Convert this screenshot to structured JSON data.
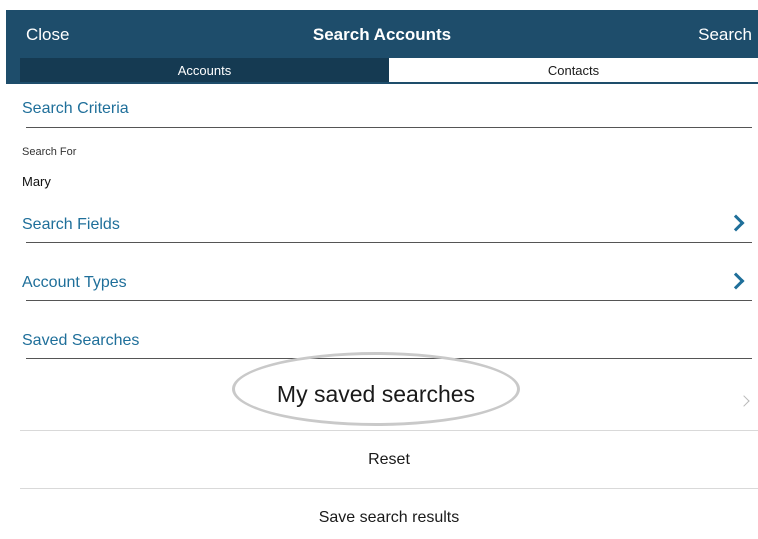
{
  "navbar": {
    "close_label": "Close",
    "title": "Search Accounts",
    "search_label": "Search"
  },
  "tabs": {
    "accounts": "Accounts",
    "contacts": "Contacts",
    "selected": "Accounts"
  },
  "search_criteria": {
    "header": "Search Criteria",
    "search_for_label": "Search For",
    "search_for_value": "Mary"
  },
  "rows": {
    "search_fields": "Search Fields",
    "account_types": "Account Types"
  },
  "saved_searches": {
    "header": "Saved Searches",
    "item_label": "My saved searches"
  },
  "actions": {
    "reset": "Reset",
    "save_results": "Save search results"
  },
  "colors": {
    "navbar": "#1e4d6b",
    "selected_tab": "#153a52",
    "accent_text": "#1f6f9a"
  },
  "icons": {
    "row_chevron": "chevron-right-icon",
    "saved_chevron": "chevron-right-icon"
  }
}
